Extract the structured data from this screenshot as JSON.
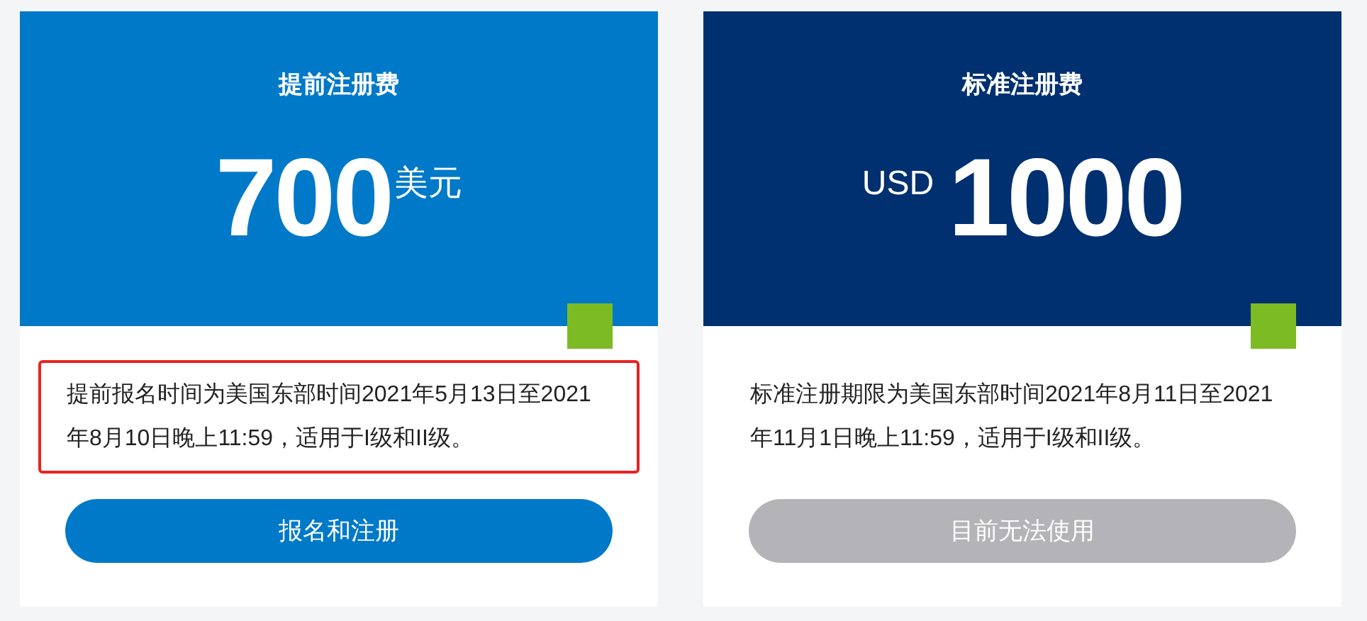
{
  "cards": [
    {
      "title": "提前注册费",
      "amount": "700",
      "currency": "美元",
      "kind": "suffix",
      "color": "#0079c8",
      "description": "提前报名时间为美国东部时间2021年5月13日至2021年8月10日晚上11:59，适用于I级和II级。",
      "highlighted": true,
      "button": {
        "label": "报名和注册",
        "disabled": false
      }
    },
    {
      "title": "标准注册费",
      "amount": "1000",
      "currency": "USD",
      "kind": "prefix",
      "color": "#003070",
      "description": "标准注册期限为美国东部时间2021年8月11日至2021年11月1日晚上11:59，适用于I级和II级。",
      "highlighted": false,
      "button": {
        "label": "目前无法使用",
        "disabled": true
      }
    }
  ]
}
